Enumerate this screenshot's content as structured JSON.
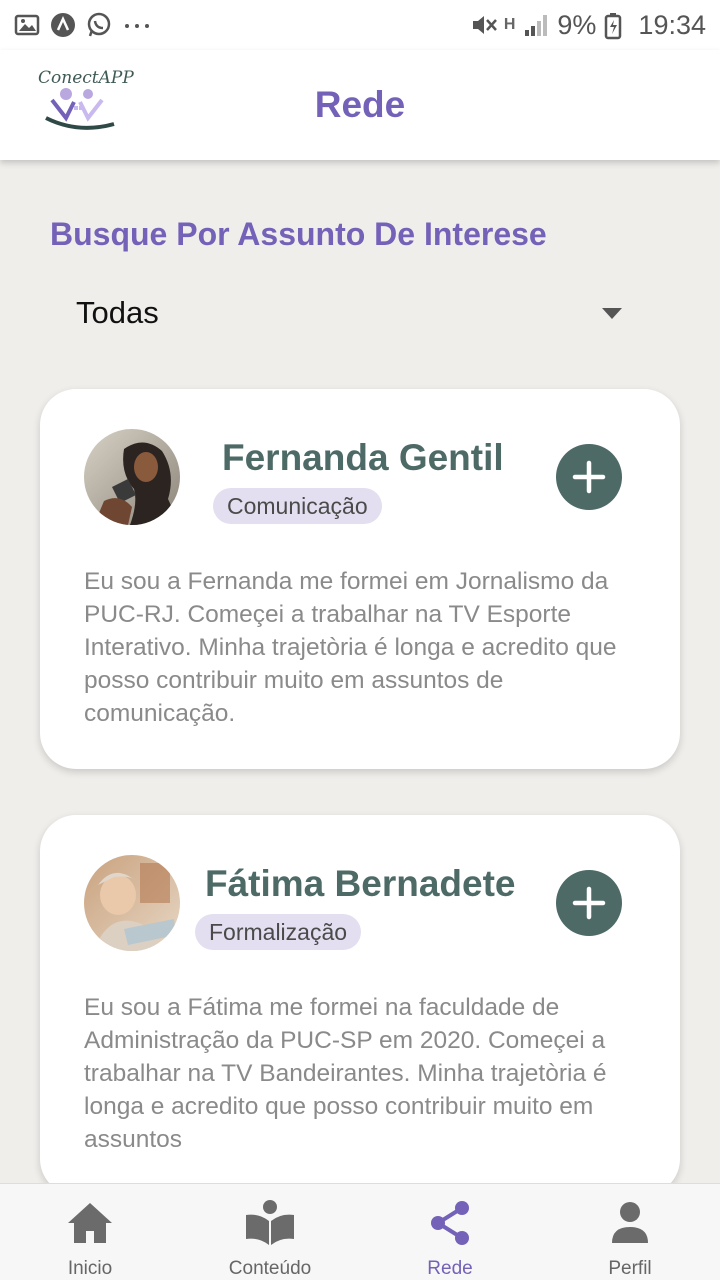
{
  "status_bar": {
    "battery": "9%",
    "time": "19:34",
    "network": "H",
    "icons": [
      "image-icon",
      "app-icon",
      "whatsapp-icon",
      "more-icon",
      "mute-icon",
      "signal-icon",
      "battery-icon"
    ]
  },
  "header": {
    "logo_text": "ConectAPP",
    "title": "Rede"
  },
  "filter": {
    "heading": "Busque Por Assunto De Interese",
    "selected": "Todas"
  },
  "profiles": [
    {
      "name": "Fernanda Gentil",
      "tag": "Comunicação",
      "bio": "Eu sou a Fernanda me formei em Jornalismo da PUC-RJ. Começei a trabalhar na  TV Esporte Interativo. Minha trajetòria é longa e acredito que posso contribuir muito em assuntos de comunicação."
    },
    {
      "name": "Fátima Bernadete",
      "tag": "Formalização",
      "bio": "Eu sou a Fátima me formei na faculdade de Administração da PUC-SP em 2020. Começei a trabalhar na TV Bandeirantes. Minha trajetòria é longa e acredito que posso contribuir muito em assuntos"
    }
  ],
  "bottom_nav": {
    "items": [
      {
        "label": "Inicio",
        "icon": "home-icon"
      },
      {
        "label": "Conteúdo",
        "icon": "book-icon"
      },
      {
        "label": "Rede",
        "icon": "share-icon",
        "active": true
      },
      {
        "label": "Perfil",
        "icon": "person-icon"
      }
    ]
  },
  "colors": {
    "accent": "#7461b8",
    "primary": "#4d6a66",
    "background": "#f0eeeb",
    "tag_bg": "#e3dff0"
  }
}
